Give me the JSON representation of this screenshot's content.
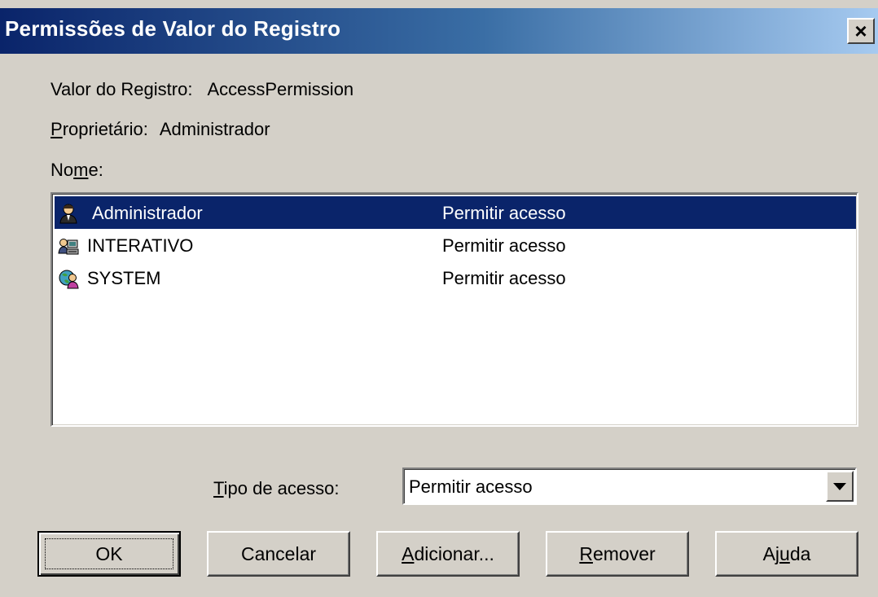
{
  "window": {
    "title": "Permissões de Valor do Registro",
    "close_glyph": "×"
  },
  "info": {
    "registry_value_label": "Valor do Registro:",
    "registry_value": "AccessPermission",
    "owner_label_mnemonic": "P",
    "owner_label_rest": "roprietário:",
    "owner_value": "Administrador",
    "name_label_pre": "No",
    "name_label_mnemonic": "m",
    "name_label_post": "e:"
  },
  "entries": [
    {
      "name": "Administrador",
      "access": "Permitir acesso",
      "icon": "user-icon",
      "selected": true
    },
    {
      "name": "INTERATIVO",
      "access": "Permitir acesso",
      "icon": "interactive-group-icon",
      "selected": false
    },
    {
      "name": "SYSTEM",
      "access": "Permitir acesso",
      "icon": "system-icon",
      "selected": false
    }
  ],
  "access_type": {
    "label_mnemonic": "T",
    "label_rest": "ipo de acesso:",
    "selected_value": "Permitir acesso"
  },
  "buttons": {
    "ok": "OK",
    "cancel": "Cancelar",
    "add_mnemonic": "A",
    "add_rest": "dicionar...",
    "remove_mnemonic": "R",
    "remove_rest": "emover",
    "help_pre": "Aj",
    "help_mnemonic": "u",
    "help_post": "da"
  },
  "colors": {
    "face": "#d4d0c8",
    "selection": "#0a246a",
    "title_start": "#0a246a",
    "title_end": "#a6caf0"
  }
}
